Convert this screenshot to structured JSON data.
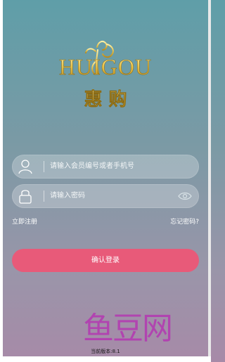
{
  "logo": {
    "brand_en": "HUIGOU",
    "brand_cn": "惠 购"
  },
  "form": {
    "account_placeholder": "请输入会员编号或者手机号",
    "password_placeholder": "请输入密码"
  },
  "links": {
    "register": "立即注册",
    "forgot_password": "忘记密码?"
  },
  "login_button": "确认登录",
  "watermark": "鱼豆网",
  "version": "当前版本:8.1",
  "icons": {
    "account": "user-icon",
    "password": "lock-icon",
    "toggle_password": "eye-icon"
  },
  "colors": {
    "button": "#e85a79",
    "logo_gold": "#e8c24a",
    "watermark": "#b33cb1"
  }
}
